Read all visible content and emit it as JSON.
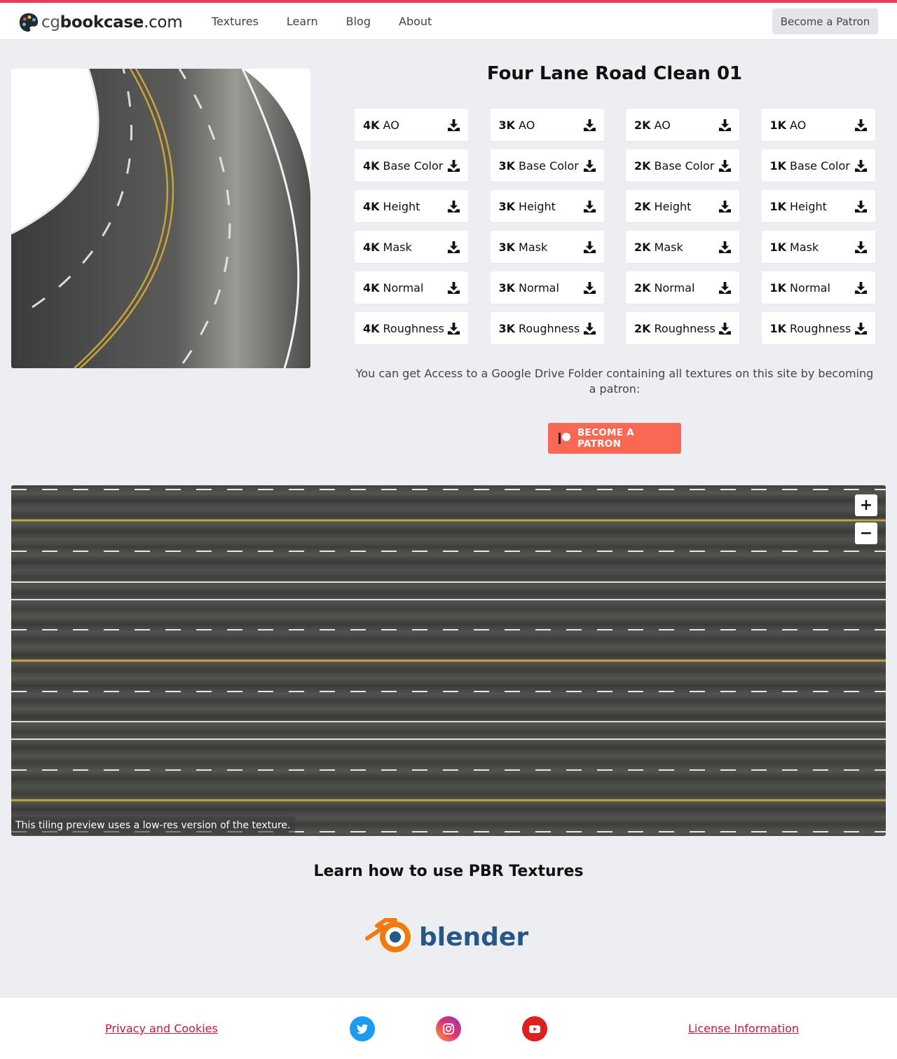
{
  "brand": {
    "prefix": "cg",
    "name": "bookcase",
    "tld": ".com"
  },
  "nav": {
    "items": [
      "Textures",
      "Learn",
      "Blog",
      "About"
    ]
  },
  "header": {
    "patron_button": "Become a Patron"
  },
  "texture": {
    "title": "Four Lane Road Clean 01",
    "downloads": [
      [
        "4K",
        "AO"
      ],
      [
        "3K",
        "AO"
      ],
      [
        "2K",
        "AO"
      ],
      [
        "1K",
        "AO"
      ],
      [
        "4K",
        "Base Color"
      ],
      [
        "3K",
        "Base Color"
      ],
      [
        "2K",
        "Base Color"
      ],
      [
        "1K",
        "Base Color"
      ],
      [
        "4K",
        "Height"
      ],
      [
        "3K",
        "Height"
      ],
      [
        "2K",
        "Height"
      ],
      [
        "1K",
        "Height"
      ],
      [
        "4K",
        "Mask"
      ],
      [
        "3K",
        "Mask"
      ],
      [
        "2K",
        "Mask"
      ],
      [
        "1K",
        "Mask"
      ],
      [
        "4K",
        "Normal"
      ],
      [
        "3K",
        "Normal"
      ],
      [
        "2K",
        "Normal"
      ],
      [
        "1K",
        "Normal"
      ],
      [
        "4K",
        "Roughness"
      ],
      [
        "3K",
        "Roughness"
      ],
      [
        "2K",
        "Roughness"
      ],
      [
        "1K",
        "Roughness"
      ]
    ]
  },
  "patron": {
    "note": "You can get Access to a Google Drive Folder containing all textures on this site by becoming a patron:",
    "button": "BECOME A PATRON",
    "color": "#f96854"
  },
  "tiling": {
    "zoom_in": "+",
    "zoom_out": "−",
    "caption": "This tiling preview uses a low-res version of the texture."
  },
  "learn": {
    "heading": "Learn how to use PBR Textures",
    "logo_text": "blender"
  },
  "footer": {
    "privacy": "Privacy and Cookies",
    "license": "License Information",
    "social": [
      "twitter-icon",
      "instagram-icon",
      "youtube-icon"
    ]
  },
  "colors": {
    "accent": "#ea3a5a",
    "link": "#c41a3a",
    "background": "#eceef1"
  }
}
